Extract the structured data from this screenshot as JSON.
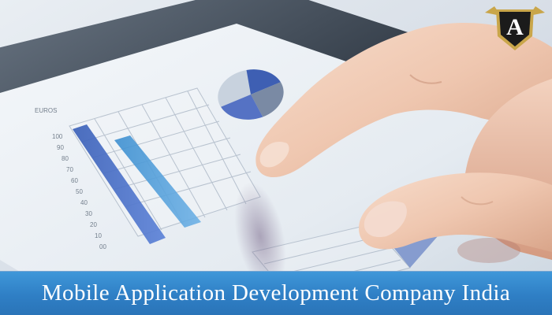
{
  "banner": {
    "text": "Mobile Application Development Company India",
    "background": "#2f7fc5",
    "text_color": "#ffffff"
  },
  "logo": {
    "letter": "A",
    "colors": [
      "#1b1b1b",
      "#c9a64a"
    ]
  },
  "tablet_chart": {
    "header": "EUROS",
    "y_ticks": [
      "100",
      "90",
      "80",
      "70",
      "60",
      "50",
      "40",
      "30",
      "20",
      "10",
      "00"
    ]
  }
}
